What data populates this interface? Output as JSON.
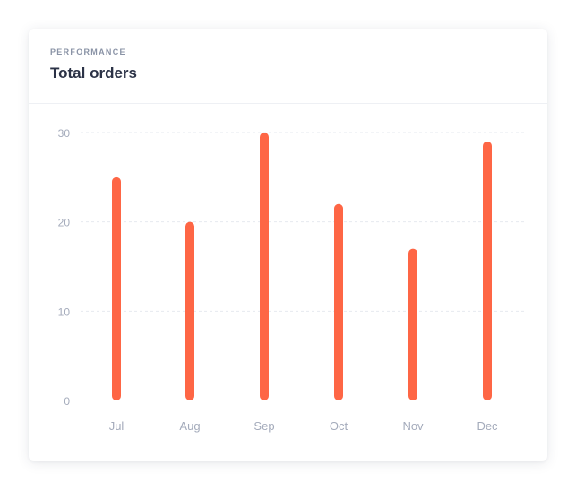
{
  "card": {
    "overline": "PERFORMANCE",
    "title": "Total orders"
  },
  "colors": {
    "bar": "#fe6645",
    "grid": "#e6e9ef",
    "tick_label": "#a4abbb"
  },
  "chart_data": {
    "type": "bar",
    "categories": [
      "Jul",
      "Aug",
      "Sep",
      "Oct",
      "Nov",
      "Dec"
    ],
    "values": [
      25,
      20,
      30,
      22,
      17,
      29
    ],
    "yticks": [
      0,
      10,
      20,
      30
    ],
    "ylim": [
      0,
      30
    ],
    "grid": true,
    "title": "Total orders",
    "xlabel": "",
    "ylabel": ""
  }
}
